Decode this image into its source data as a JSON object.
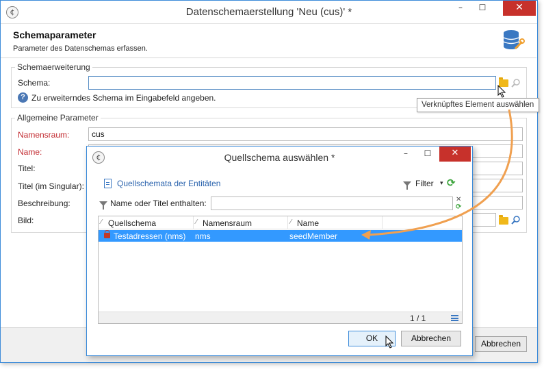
{
  "main_window": {
    "title": "Datenschemaerstellung 'Neu (cus)' *",
    "controls": {
      "minimize": "–",
      "maximize": "☐",
      "close": "✕"
    },
    "header": {
      "title": "Schemaparameter",
      "subtitle": "Parameter des Datenschemas erfassen."
    },
    "schema_extension": {
      "group_label": "Schemaerweiterung",
      "schema_label": "Schema:",
      "schema_value": "",
      "help_text": "Zu erweiterndes Schema im Eingabefeld angeben."
    },
    "tooltip": "Verknüpftes Element auswählen",
    "general": {
      "group_label": "Allgemeine Parameter",
      "fields": [
        {
          "label": "Namensraum:",
          "value": "cus",
          "required": true
        },
        {
          "label": "Name:",
          "value": "",
          "required": true
        },
        {
          "label": "Titel:",
          "value": "",
          "required": false
        },
        {
          "label": "Titel (im Singular):",
          "value": "",
          "required": false
        },
        {
          "label": "Beschreibung:",
          "value": "",
          "required": false
        },
        {
          "label": "Bild:",
          "value": "",
          "required": false
        }
      ]
    },
    "cancel_label": "Abbrechen"
  },
  "dialog": {
    "title": "Quellschema auswählen *",
    "controls": {
      "minimize": "–",
      "maximize": "☐",
      "close": "✕"
    },
    "toolbar": {
      "link": "Quellschemata der Entitäten",
      "filter_label": "Filter",
      "caret": "▾",
      "refresh": "⟳"
    },
    "filter": {
      "label": "Name oder Titel enthalten:",
      "value": "",
      "clear": "✕"
    },
    "columns": [
      "Quellschema",
      "Namensraum",
      "Name"
    ],
    "sort_mark": "⁄",
    "rows": [
      {
        "schema": "Testadressen (nms)",
        "namespace": "nms",
        "name": "seedMember",
        "selected": true
      }
    ],
    "pager": "1 / 1",
    "ok_label": "OK",
    "cancel_label": "Abbrechen"
  },
  "colors": {
    "accent": "#3c8bd9",
    "selection": "#3399ff",
    "required_label": "#c1272d",
    "arrow": "#f0a050",
    "close_button": "#c7312b"
  }
}
